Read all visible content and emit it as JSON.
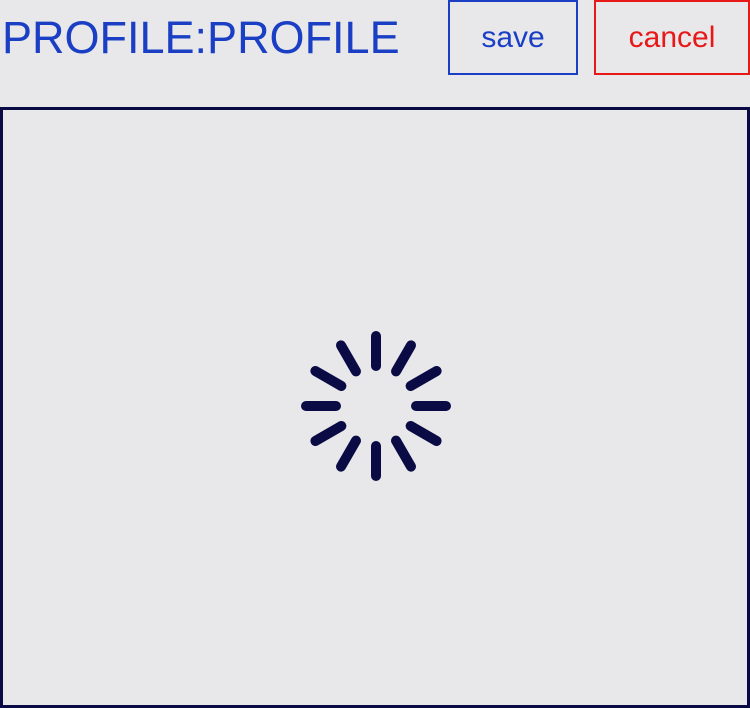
{
  "header": {
    "title": "PROFILE:PROFILE",
    "save_label": "save",
    "cancel_label": "cancel"
  },
  "colors": {
    "title": "#1a3fc4",
    "save": "#1a3fc4",
    "cancel": "#e81818",
    "panel_border": "#0a0a45",
    "spinner": "#0a0a45",
    "background": "#e8e8ea"
  },
  "content": {
    "loading_icon": "spinner-icon"
  }
}
